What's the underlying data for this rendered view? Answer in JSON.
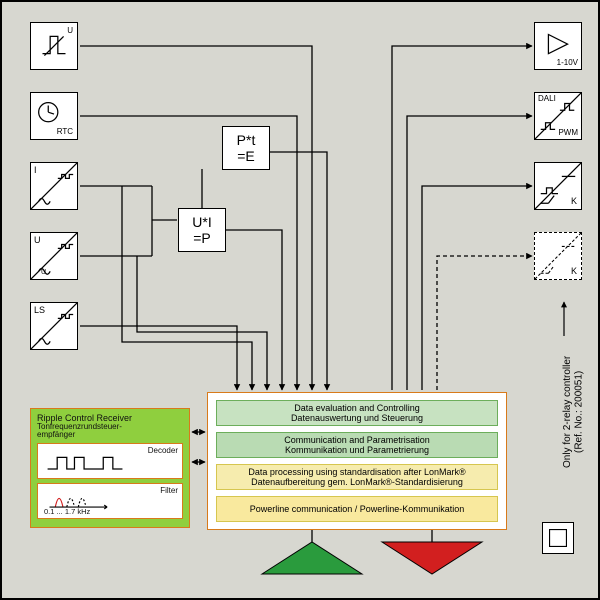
{
  "sensors": {
    "varistor": {
      "caption": "U"
    },
    "rtc": {
      "caption": "RTC"
    },
    "current": {
      "glyph_main": "I",
      "glyph_sub": ""
    },
    "voltage": {
      "glyph_main": "U",
      "glyph_sub": "U"
    },
    "ls": {
      "glyph_main": "LS",
      "glyph_sub": ""
    }
  },
  "calc": {
    "ui_p": "U*I\n=P",
    "pt_e": "P*t\n=E"
  },
  "outputs": {
    "amp": {
      "caption": "1-10V"
    },
    "dali": {
      "top": "DALI",
      "bottom": "PWM"
    },
    "relay1": {
      "k": "K"
    },
    "relay2": {
      "k": "K"
    }
  },
  "central": {
    "l1": {
      "en": "Data evaluation and Controlling",
      "de": "Datenauswertung und Steuerung"
    },
    "l2": {
      "en": "Communication and Parametrisation",
      "de": "Kommunikation und Parametrierung"
    },
    "l3": {
      "en": "Data processing using standardisation after LonMark®",
      "de": "Datenaufbereitung gem. LonMark®-Standardisierung"
    },
    "l4": {
      "en": "Powerline communication / Powerline-Kommunikation"
    }
  },
  "ripple": {
    "title": "Ripple Control Receiver",
    "subtitle": "Tonfrequenzrundsteuer-\nempfänger",
    "decoder": "Decoder",
    "filter": "Filter",
    "range": "0.1 ... 1.7 kHz"
  },
  "footnote": "Only for 2-relay controller\n(Ref. No.: 200051)",
  "chart_data": {
    "type": "flow-diagram",
    "blocks": [
      {
        "id": "varistor",
        "label": "Varistor / overvoltage input (U)"
      },
      {
        "id": "rtc",
        "label": "Real-time clock (RTC)"
      },
      {
        "id": "current",
        "label": "Current transducer (I)"
      },
      {
        "id": "voltage",
        "label": "Voltage transducer (U)"
      },
      {
        "id": "ls",
        "label": "LS transducer"
      },
      {
        "id": "ui_p",
        "label": "U*I = P"
      },
      {
        "id": "pt_e",
        "label": "P*t = E"
      },
      {
        "id": "ripple",
        "label": "Ripple Control Receiver (Decoder + Filter 0.1…1.7 kHz)"
      },
      {
        "id": "central",
        "label": "Controller stack: Data eval / Comm & Param / LonMark® processing / Powerline"
      },
      {
        "id": "amp",
        "label": "Analog output 1-10V"
      },
      {
        "id": "dali",
        "label": "DALI / PWM output"
      },
      {
        "id": "relay1",
        "label": "Relay K (1)"
      },
      {
        "id": "relay2",
        "label": "Relay K (2, dashed – optional)"
      },
      {
        "id": "tx",
        "label": "Transmit (green triangle)"
      },
      {
        "id": "rx",
        "label": "Receive (red triangle)"
      }
    ],
    "edges": [
      [
        "varistor",
        "central"
      ],
      [
        "rtc",
        "central"
      ],
      [
        "current",
        "ui_p"
      ],
      [
        "voltage",
        "ui_p"
      ],
      [
        "ui_p",
        "pt_e"
      ],
      [
        "ui_p",
        "central"
      ],
      [
        "pt_e",
        "central"
      ],
      [
        "current",
        "central"
      ],
      [
        "voltage",
        "central"
      ],
      [
        "ls",
        "central"
      ],
      [
        "ripple",
        "central",
        "bidirectional"
      ],
      [
        "central",
        "amp"
      ],
      [
        "central",
        "dali"
      ],
      [
        "central",
        "relay1"
      ],
      [
        "central",
        "relay2"
      ],
      [
        "central",
        "tx"
      ],
      [
        "central",
        "rx"
      ]
    ],
    "note": "relay2 applies only for 2-relay controller (Ref. No.: 200051)"
  }
}
